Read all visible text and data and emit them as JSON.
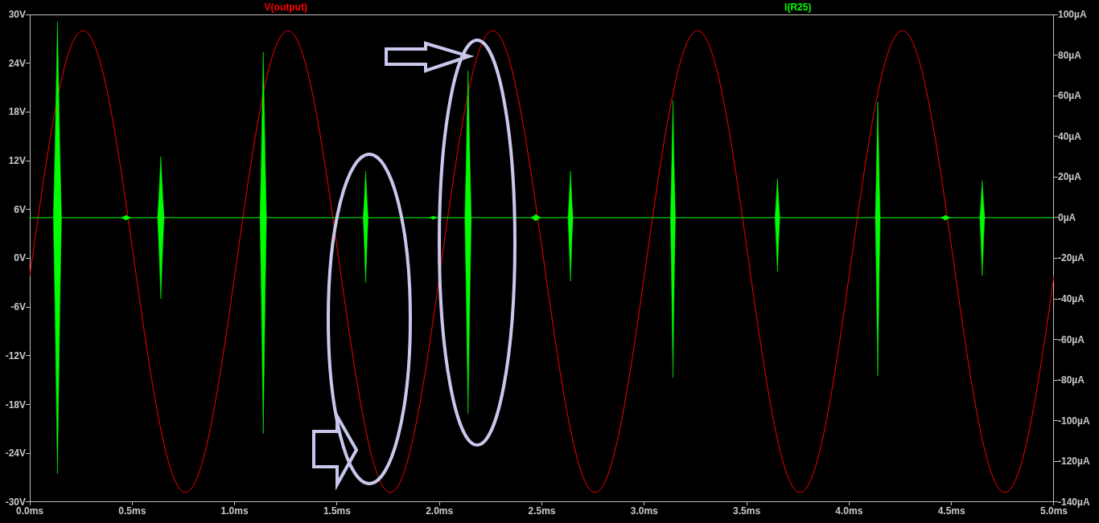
{
  "plot": {
    "traces": [
      {
        "label": "V(output)",
        "color": "#ff0000",
        "kind": "wave"
      },
      {
        "label": "I(R25)",
        "color": "#00ff00",
        "kind": "bursts"
      }
    ],
    "left_axis": {
      "ticks": [
        "30V",
        "24V",
        "18V",
        "12V",
        "6V",
        "0V",
        "-6V",
        "-12V",
        "-18V",
        "-24V",
        "-30V"
      ]
    },
    "right_axis": {
      "ticks": [
        "100µA",
        "80µA",
        "60µA",
        "40µA",
        "20µA",
        "0µA",
        "-20µA",
        "-40µA",
        "-60µA",
        "-80µA",
        "-100µA",
        "-120µA",
        "-140µA"
      ]
    },
    "x_axis": {
      "ticks": [
        "0.0ms",
        "0.5ms",
        "1.0ms",
        "1.5ms",
        "2.0ms",
        "2.5ms",
        "3.0ms",
        "3.5ms",
        "4.0ms",
        "4.5ms",
        "5.0ms"
      ]
    }
  }
}
